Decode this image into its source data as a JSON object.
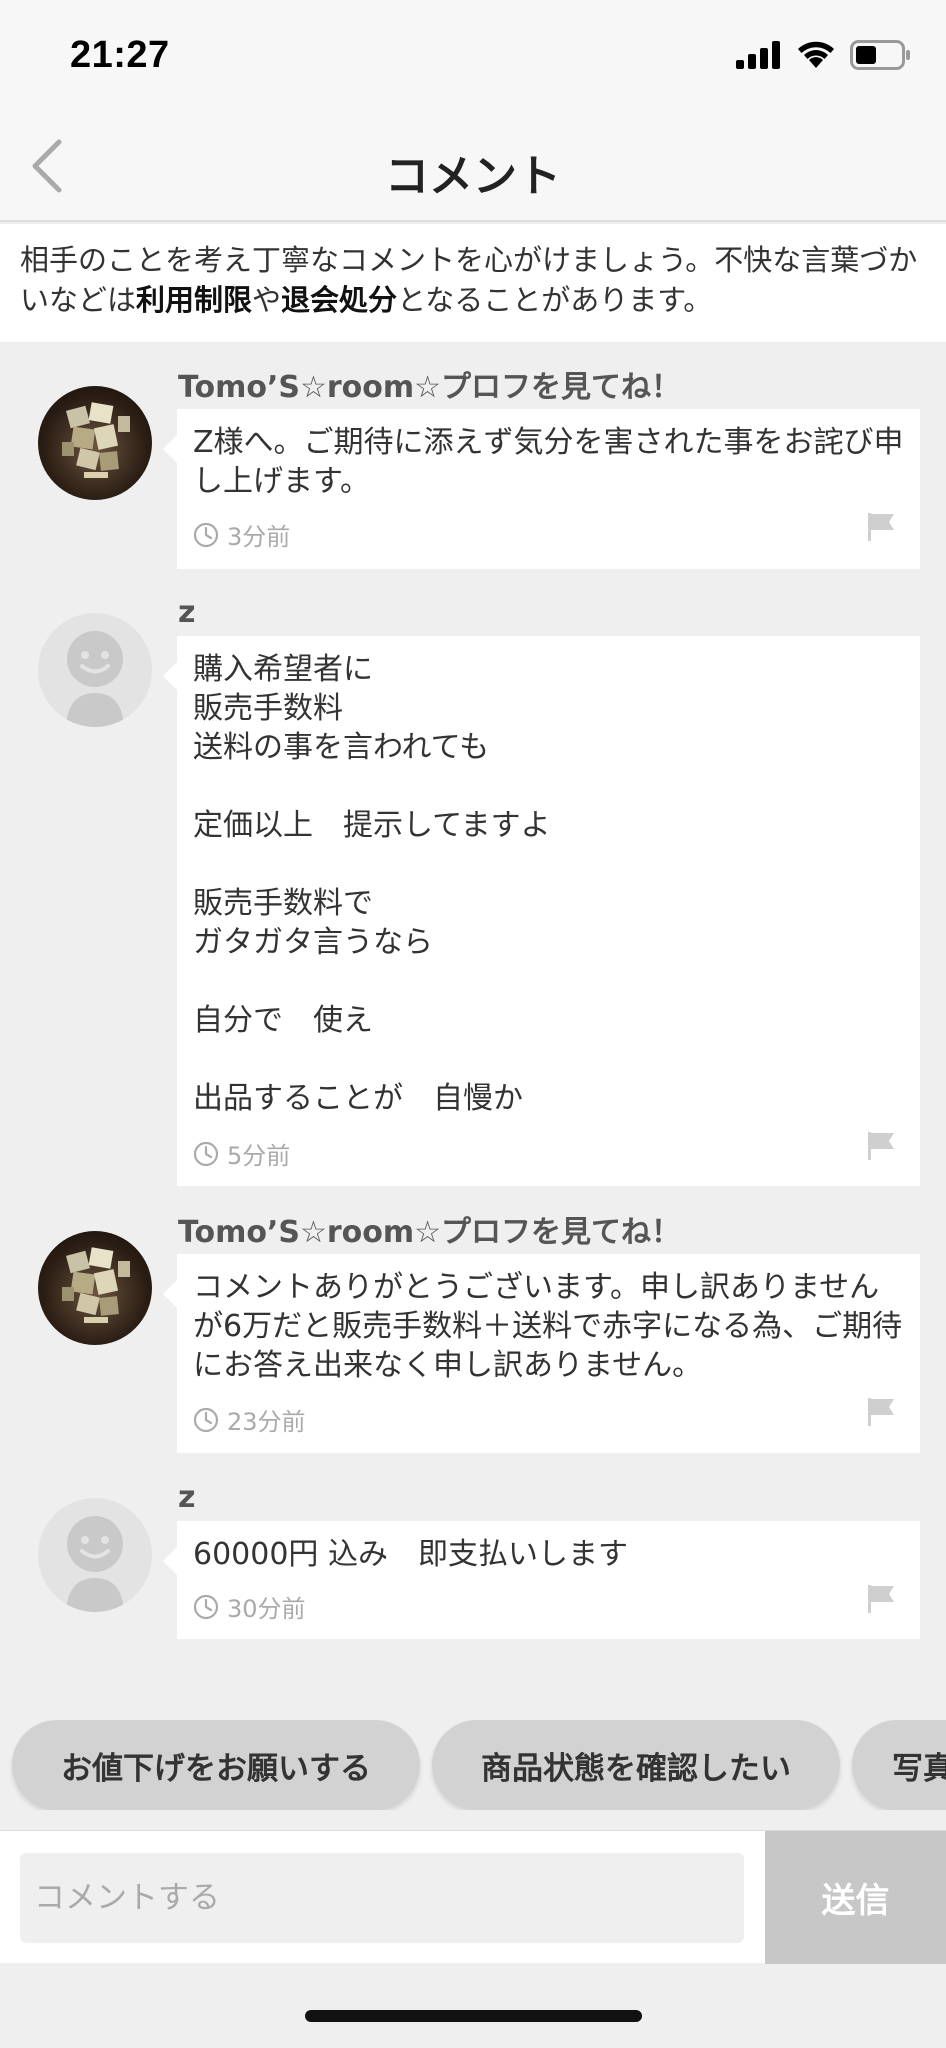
{
  "status_bar": {
    "time": "21:27"
  },
  "nav": {
    "title": "コメント"
  },
  "notice": {
    "text_1": "相手のことを考え丁寧なコメントを心がけましょう。不快な言葉づかいなどは",
    "bold_1": "利用制限",
    "text_2": "や",
    "bold_2": "退会処分",
    "text_3": "となることがあります。"
  },
  "comments": [
    {
      "author": "Tomo’S☆room☆プロフを見てね！",
      "text": "Z様へ。ご期待に添えず気分を害された事をお詫び申し上げます。",
      "time": "3分前"
    },
    {
      "author": "z",
      "text": "購入希望者に\n販売手数料\n送料の事を言われても\n\n定価以上　提示してますよ\n\n販売手数料で\nガタガタ言うなら\n\n自分で　使え\n\n出品することが　自慢か",
      "time": "5分前"
    },
    {
      "author": "Tomo’S☆room☆プロフを見てね！",
      "text": "コメントありがとうございます。申し訳ありませんが6万だと販売手数料＋送料で赤字になる為、ご期待にお答え出来なく申し訳ありません。",
      "time": "23分前"
    },
    {
      "author": "z",
      "text": "60000円  込み　即支払いします",
      "time": "30分前"
    }
  ],
  "quick_replies": [
    "お値下げをお願いする",
    "商品状態を確認したい",
    "写真"
  ],
  "input": {
    "placeholder": "コメントする",
    "send_label": "送信"
  }
}
